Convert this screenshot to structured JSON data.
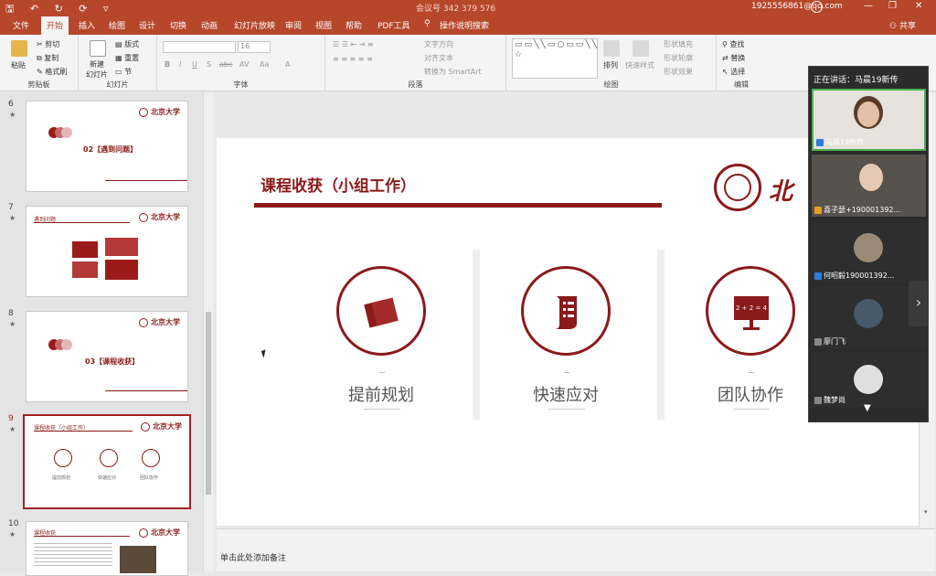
{
  "titlebar": {
    "quick_access": "🖫 ↶ ↻ ⟳ ▿",
    "document": "会议号 342 379 576",
    "account": "1925556861@qq.com",
    "controls": [
      "—",
      "❐",
      "✕"
    ]
  },
  "tabs": [
    "文件",
    "开始",
    "插入",
    "绘图",
    "设计",
    "切换",
    "动画",
    "幻灯片放映",
    "审阅",
    "视图",
    "帮助",
    "PDF工具",
    "操作说明搜索"
  ],
  "active_tab": "开始",
  "share": "共享",
  "ribbon": {
    "clipboard": {
      "paste": "粘贴",
      "cut": "剪切",
      "copy": "复制",
      "format_painter": "格式刷",
      "label": "剪贴板"
    },
    "slides": {
      "new_slide": "新建\n幻灯片",
      "layout": "版式",
      "reset": "重置",
      "section": "节",
      "label": "幻灯片"
    },
    "font": {
      "font_name": "",
      "font_size": "16",
      "bold": "B",
      "italic": "I",
      "underline": "U",
      "shadow": "S",
      "strike": "abc",
      "spacing": "AV",
      "case": "Aa",
      "color": "A",
      "label": "字体"
    },
    "paragraph": {
      "text_direction": "文字方向",
      "align_text": "对齐文本",
      "smartart": "转换为 SmartArt",
      "label": "段落"
    },
    "drawing": {
      "arrange": "排列",
      "quick_styles": "快速样式",
      "shape_fill": "形状填充",
      "shape_outline": "形状轮廓",
      "shape_effects": "形状效果",
      "label": "绘图"
    },
    "editing": {
      "find": "查找",
      "replace": "替换",
      "select": "选择",
      "label": "编辑"
    },
    "shapes_gallery": "▭▭╲╲▭○▭▭╲╲⇧⇩⬠▢☆◠◡⌒{}☆"
  },
  "thumbnails": [
    {
      "number": "6",
      "star": "★",
      "title": "02【遇到问题】"
    },
    {
      "number": "7",
      "star": "★",
      "title": "遇到问题"
    },
    {
      "number": "8",
      "star": "★",
      "title": "03【课程收获】"
    },
    {
      "number": "9",
      "star": "★",
      "title": "课程收获（小组工作）",
      "captions": [
        "提前规划",
        "快速应对",
        "团队协作"
      ]
    },
    {
      "number": "10",
      "star": "★",
      "title": "课程收获"
    }
  ],
  "slide": {
    "title": "课程收获（小组工作）",
    "logo_text": "北",
    "items": [
      {
        "label": "提前规划",
        "icon": "books-icon"
      },
      {
        "label": "快速应对",
        "icon": "scroll-icon"
      },
      {
        "label": "团队协作",
        "icon": "board-icon",
        "board_text": "2 + 2 = 4"
      }
    ]
  },
  "notes_placeholder": "单击此处添加备注",
  "video_call": {
    "speaking": "正在讲话：马晨19新传",
    "participants": [
      {
        "name": "马晨19新传"
      },
      {
        "name": "喜子瑟+190001392..."
      },
      {
        "name": "何昭毅190001392..."
      },
      {
        "name": "廖门飞"
      },
      {
        "name": "魏梦尚"
      }
    ]
  },
  "colors": {
    "accent": "#b7472a",
    "slide_red": "#8b1a1a"
  }
}
